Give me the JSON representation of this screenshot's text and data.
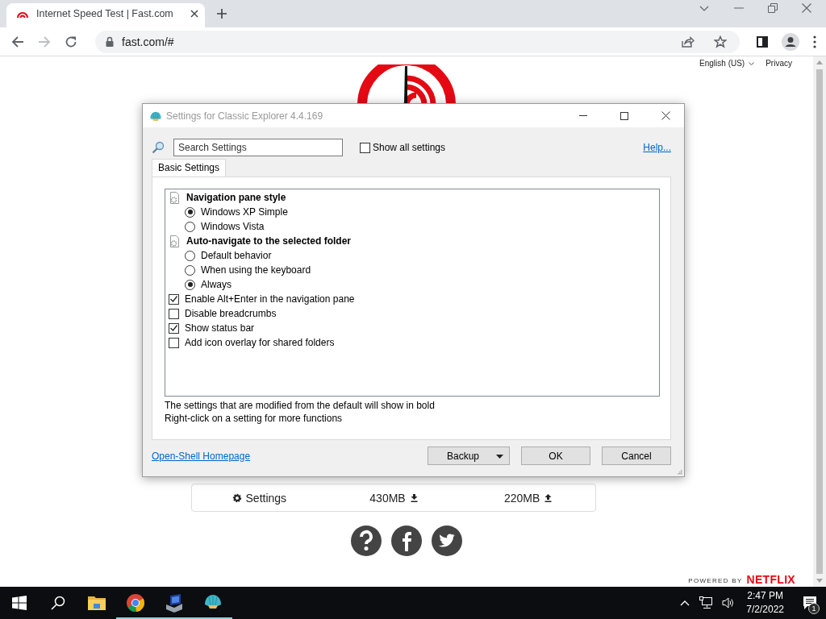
{
  "browser": {
    "tab": {
      "title": "Internet Speed Test | Fast.com"
    },
    "url": "fast.com/#"
  },
  "page": {
    "language": "English (US)",
    "privacy": "Privacy",
    "stats": [
      {
        "kind": "settings",
        "label": "Settings"
      },
      {
        "kind": "download",
        "label": "430MB"
      },
      {
        "kind": "upload",
        "label": "220MB"
      }
    ],
    "powered_by": "POWERED BY",
    "brand": "NETFLIX"
  },
  "dialog": {
    "title": "Settings for Classic Explorer 4.4.169",
    "search": {
      "placeholder": "Search Settings"
    },
    "show_all": {
      "label": "Show all settings",
      "checked": false
    },
    "help": "Help...",
    "tabs": [
      {
        "label": "Basic Settings",
        "selected": true
      }
    ],
    "settings": [
      {
        "kind": "group",
        "label": "Navigation pane style",
        "children": [
          {
            "kind": "radio",
            "label": "Windows XP Simple",
            "selected": true
          },
          {
            "kind": "radio",
            "label": "Windows Vista",
            "selected": false
          }
        ]
      },
      {
        "kind": "group",
        "label": "Auto-navigate to the selected folder",
        "children": [
          {
            "kind": "radio",
            "label": "Default behavior",
            "selected": false
          },
          {
            "kind": "radio",
            "label": "When using the keyboard",
            "selected": false
          },
          {
            "kind": "radio",
            "label": "Always",
            "selected": true
          }
        ]
      },
      {
        "kind": "checkbox",
        "label": "Enable Alt+Enter in the navigation pane",
        "checked": true
      },
      {
        "kind": "checkbox",
        "label": "Disable breadcrumbs",
        "checked": false
      },
      {
        "kind": "checkbox",
        "label": "Show status bar",
        "checked": true
      },
      {
        "kind": "checkbox",
        "label": "Add icon overlay for shared folders",
        "checked": false
      }
    ],
    "notes": [
      "The settings that are modified from the default will show in bold",
      "Right-click on a setting for more functions"
    ],
    "homepage_link": "Open-Shell Homepage",
    "buttons": [
      {
        "kind": "split",
        "label": "Backup"
      },
      {
        "kind": "push",
        "label": "OK"
      },
      {
        "kind": "push",
        "label": "Cancel"
      }
    ]
  },
  "taskbar": {
    "apps": [
      {
        "kind": "folder",
        "running": false
      },
      {
        "kind": "browser",
        "running": true
      },
      {
        "kind": "computer",
        "running": true
      },
      {
        "kind": "shell",
        "running": true
      }
    ],
    "time": "2:47 PM",
    "date": "7/2/2022",
    "notification_count": "1"
  }
}
